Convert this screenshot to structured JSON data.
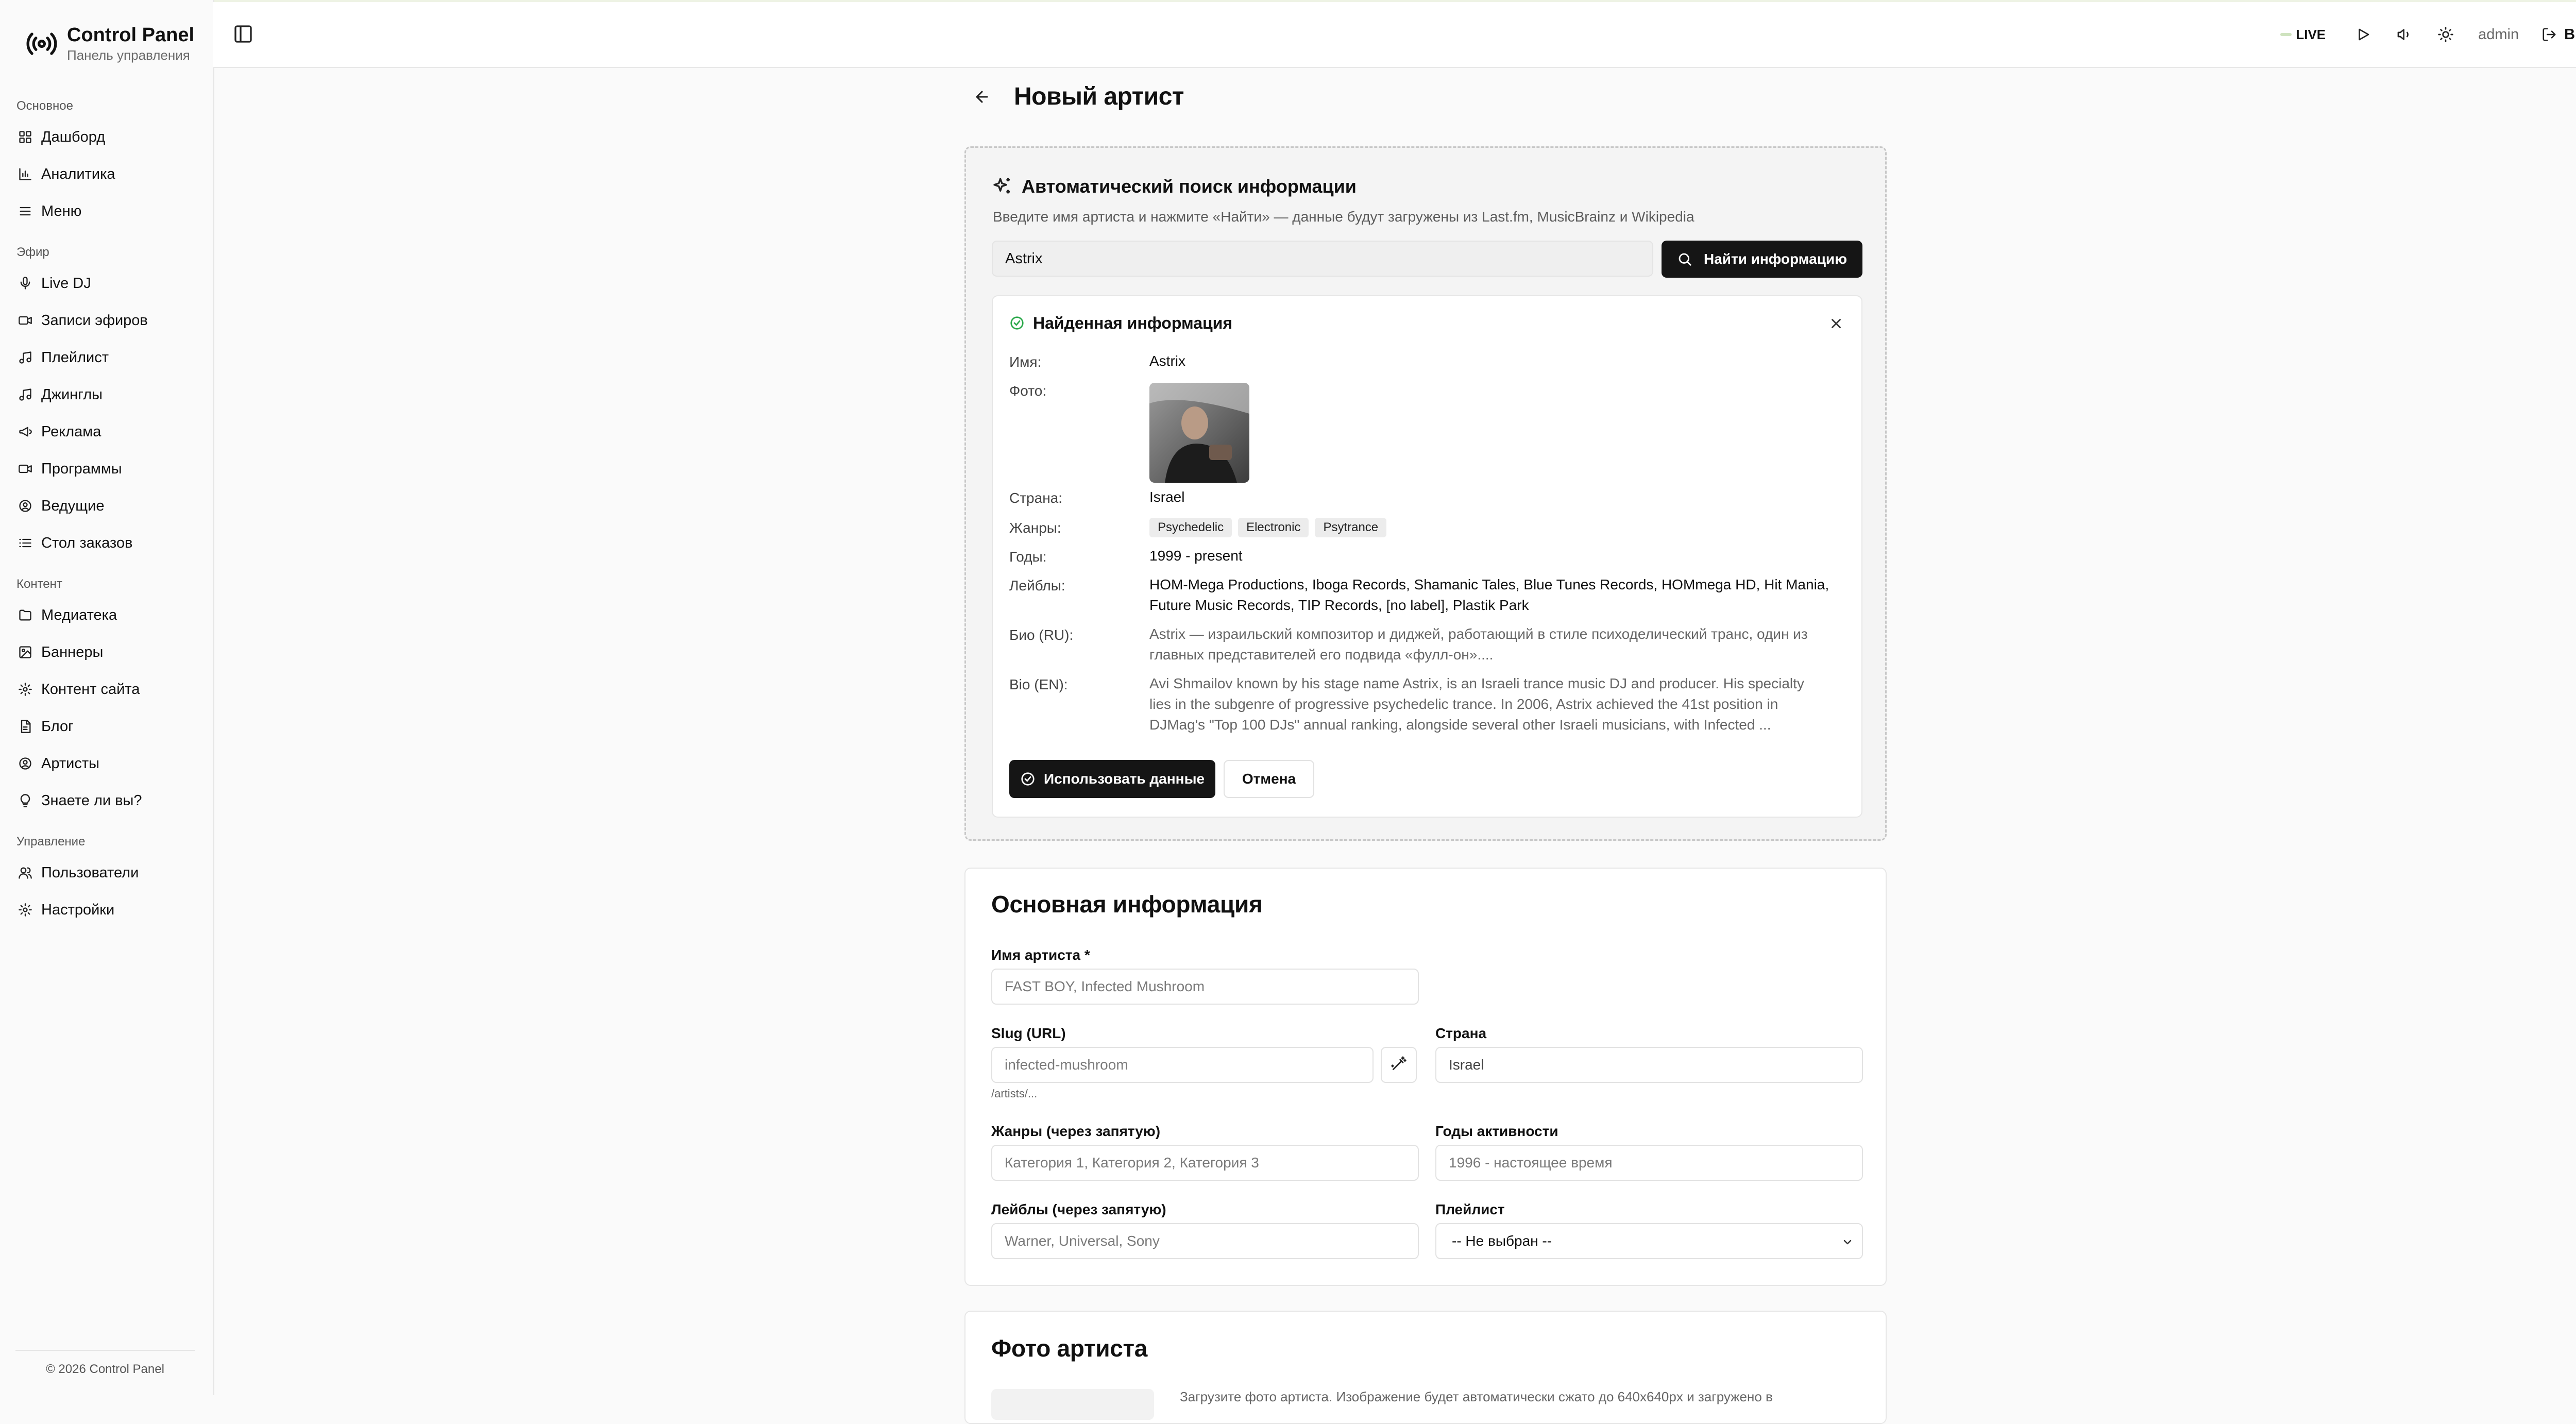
{
  "app": {
    "title": "Control Panel",
    "subtitle": "Панель управления",
    "footer": "© 2026 Control Panel"
  },
  "sidebar": {
    "groups": [
      {
        "title": "Основное",
        "items": [
          {
            "label": "Дашборд",
            "icon": "dashboard-icon"
          },
          {
            "label": "Аналитика",
            "icon": "chart-icon"
          },
          {
            "label": "Меню",
            "icon": "menu-icon"
          }
        ]
      },
      {
        "title": "Эфир",
        "items": [
          {
            "label": "Live DJ",
            "icon": "mic-icon"
          },
          {
            "label": "Записи эфиров",
            "icon": "video-icon"
          },
          {
            "label": "Плейлист",
            "icon": "music-icon"
          },
          {
            "label": "Джинглы",
            "icon": "music-icon"
          },
          {
            "label": "Реклама",
            "icon": "megaphone-icon"
          },
          {
            "label": "Программы",
            "icon": "video-icon"
          },
          {
            "label": "Ведущие",
            "icon": "user-circle-icon"
          },
          {
            "label": "Стол заказов",
            "icon": "list-icon"
          }
        ]
      },
      {
        "title": "Контент",
        "items": [
          {
            "label": "Медиатека",
            "icon": "folder-icon"
          },
          {
            "label": "Баннеры",
            "icon": "image-icon"
          },
          {
            "label": "Контент сайта",
            "icon": "gear-icon"
          },
          {
            "label": "Блог",
            "icon": "document-icon"
          },
          {
            "label": "Артисты",
            "icon": "user-circle-icon"
          },
          {
            "label": "Знаете ли вы?",
            "icon": "lightbulb-icon"
          }
        ]
      },
      {
        "title": "Управление",
        "items": [
          {
            "label": "Пользователи",
            "icon": "users-icon"
          },
          {
            "label": "Настройки",
            "icon": "gear-icon"
          }
        ]
      }
    ]
  },
  "header": {
    "live_label": "LIVE",
    "user": "admin",
    "logout_label": "Выход"
  },
  "page": {
    "title": "Новый артист"
  },
  "auto_search": {
    "title": "Автоматический поиск информации",
    "description": "Введите имя артиста и нажмите «Найти» — данные будут загружены из Last.fm, MusicBrainz и Wikipedia",
    "query": "Astrix",
    "find_label": "Найти информацию"
  },
  "found": {
    "title": "Найденная информация",
    "labels": {
      "name": "Имя:",
      "photo": "Фото:",
      "country": "Страна:",
      "genres": "Жанры:",
      "years": "Годы:",
      "labels": "Лейблы:",
      "bio_ru": "Био (RU):",
      "bio_en": "Bio (EN):"
    },
    "name": "Astrix",
    "country": "Israel",
    "genres": [
      "Psychedelic",
      "Electronic",
      "Psytrance"
    ],
    "years": "1999 - present",
    "record_labels_line1": "HOM-Mega Productions, Iboga Records, Shamanic Tales, Blue Tunes Records, HOMmega HD, Hit Mania,",
    "record_labels_line2": "Future Music Records, TIP Records, [no label], Plastik Park",
    "bio_ru_line1": "Astrix — израильский композитор и диджей, работающий в стиле психоделический транс, один из",
    "bio_ru_line2": "главных представителей его подвида «фулл-он»....",
    "bio_en_line1": "Avi Shmailov known by his stage name Astrix, is an Israeli trance music DJ and producer. His specialty",
    "bio_en_line2": "lies in the subgenre of progressive psychedelic trance. In 2006, Astrix achieved the 41st position in",
    "bio_en_line3": "DJMag's \"Top 100 DJs\" annual ranking, alongside several other Israeli musicians, with Infected ...",
    "use_label": "Использовать данные",
    "cancel_label": "Отмена"
  },
  "basic_info": {
    "title": "Основная информация",
    "name_label": "Имя артиста *",
    "name_placeholder": "FAST BOY, Infected Mushroom",
    "slug_label": "Slug (URL)",
    "slug_placeholder": "infected-mushroom",
    "slug_hint": "/artists/...",
    "country_label": "Страна",
    "country_value": "Israel",
    "genres_label": "Жанры (через запятую)",
    "genres_placeholder": "Категория 1, Категория 2, Категория 3",
    "years_label": "Годы активности",
    "years_placeholder": "1996 - настоящее время",
    "labels_label": "Лейблы (через запятую)",
    "labels_placeholder": "Warner, Universal, Sony",
    "playlist_label": "Плейлист",
    "playlist_value": "-- Не выбран --"
  },
  "photo_section": {
    "title": "Фото артиста",
    "description": "Загрузите фото артиста. Изображение будет автоматически сжато до 640x640px и загружено в"
  }
}
